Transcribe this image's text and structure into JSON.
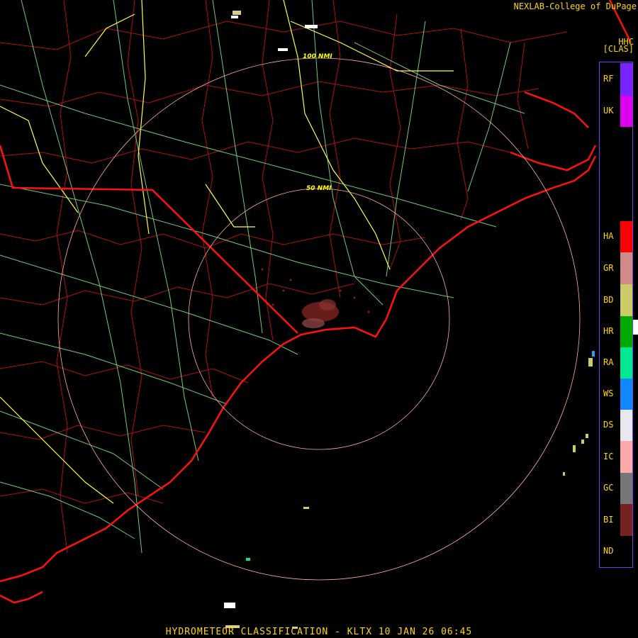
{
  "header": {
    "credit": "NEXLAB-College of DuPage",
    "product_code": "HHC",
    "mode": "[CLAS]"
  },
  "footer": {
    "title": "HYDROMETEOR CLASSIFICATION - KLTX 10 JAN 26 06:45"
  },
  "range_rings": [
    {
      "label": "50 NMI"
    },
    {
      "label": "100 NMI"
    }
  ],
  "legend": [
    {
      "code": "RF",
      "color": "#7a22ff"
    },
    {
      "code": "UK",
      "color": "#dd00ee"
    },
    {
      "code": "HA",
      "color": "#ff0000"
    },
    {
      "code": "GR",
      "color": "#d08a8a"
    },
    {
      "code": "BD",
      "color": "#cccc66"
    },
    {
      "code": "HR",
      "color": "#00aa00"
    },
    {
      "code": "RA",
      "color": "#00e890"
    },
    {
      "code": "WS",
      "color": "#1188ff"
    },
    {
      "code": "DS",
      "color": "#e8e8ee"
    },
    {
      "code": "IC",
      "color": "#ffaaaa"
    },
    {
      "code": "GC",
      "color": "#777777"
    },
    {
      "code": "BI",
      "color": "#772222"
    },
    {
      "code": "ND",
      "color": "#000000"
    }
  ],
  "colors": {
    "coast_state": "#ff1111",
    "county": "#b01010",
    "interstate": "#ffff44",
    "highway": "#88ee88",
    "ring": "#ffb0a0"
  }
}
